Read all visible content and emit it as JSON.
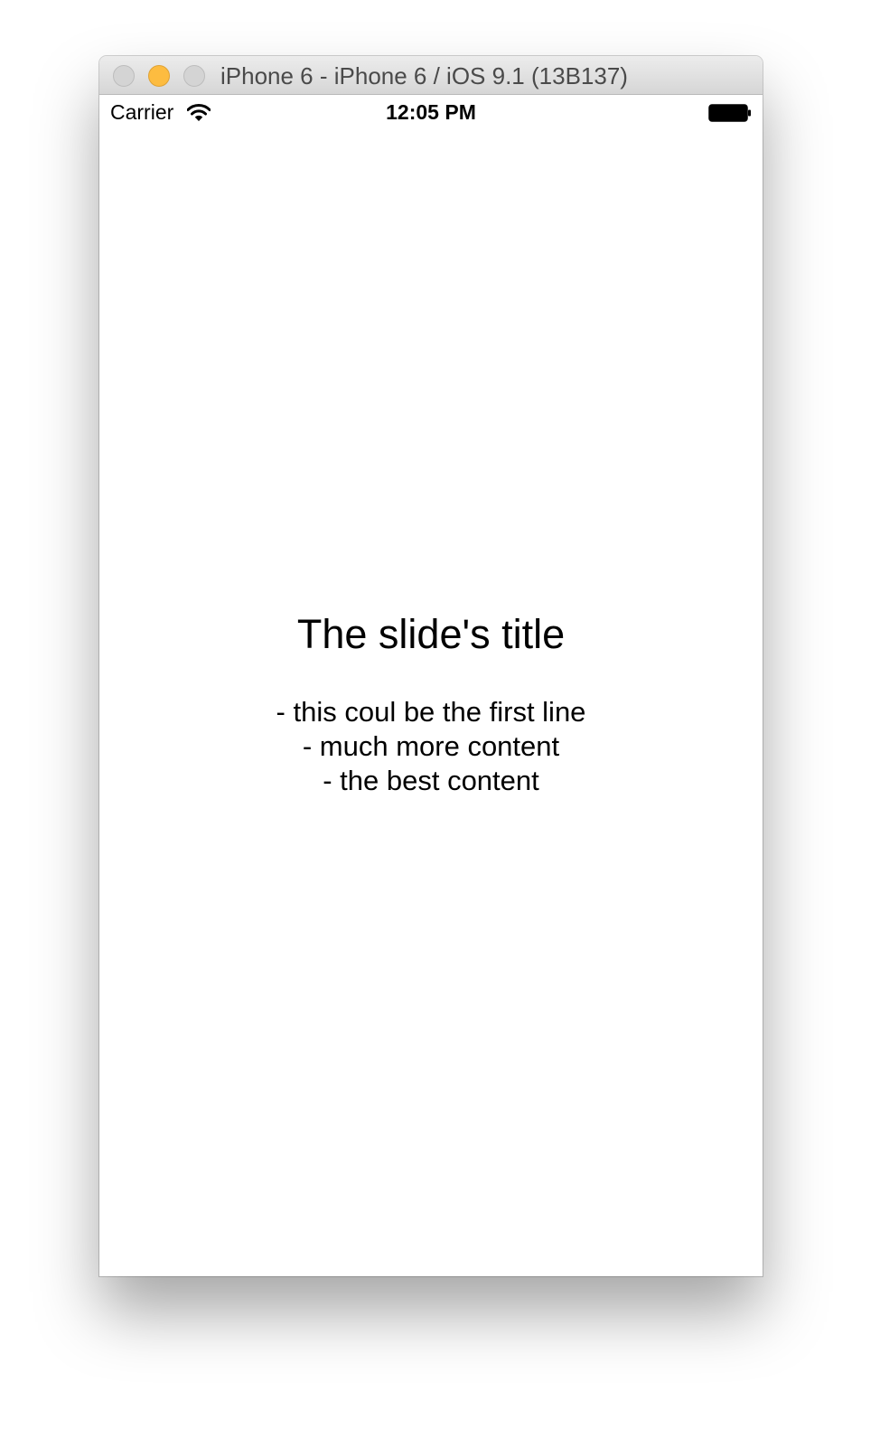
{
  "window": {
    "title": "iPhone 6 - iPhone 6 / iOS 9.1 (13B137)"
  },
  "statusbar": {
    "carrier": "Carrier",
    "time": "12:05 PM",
    "wifi_icon": "wifi-icon",
    "battery_icon": "battery-icon"
  },
  "slide": {
    "title": "The slide's title",
    "lines": [
      "- this coul be the first line",
      "- much more content",
      "- the best content"
    ]
  },
  "colors": {
    "minimize_button": "#fdbc40",
    "inactive_button": "#d4d4d4",
    "text": "#000000"
  }
}
